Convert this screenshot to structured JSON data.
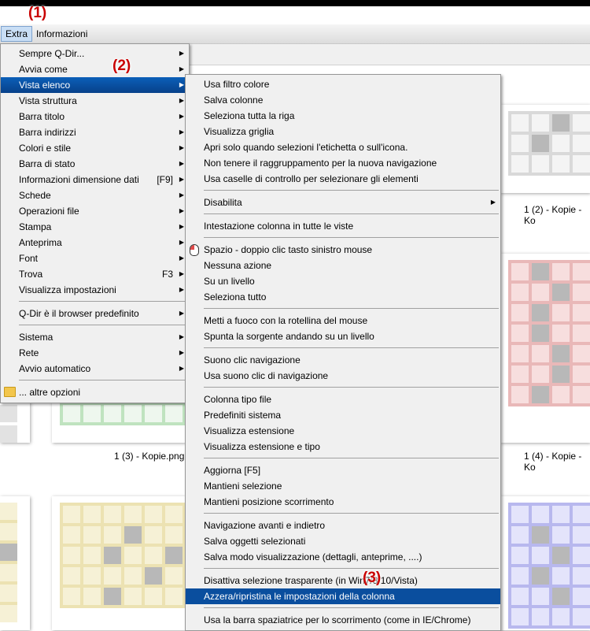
{
  "menubar": {
    "extra": "Extra",
    "info": "Informazioni"
  },
  "callouts": [
    "(1)",
    "(2)",
    "(3)"
  ],
  "extra_menu": [
    {
      "label": "Sempre Q-Dir...",
      "arrow": true
    },
    {
      "label": "Avvia come",
      "arrow": true
    },
    {
      "label": "Vista elenco",
      "arrow": true,
      "selected": true
    },
    {
      "label": "Vista struttura",
      "arrow": true
    },
    {
      "label": "Barra titolo",
      "arrow": true
    },
    {
      "label": "Barra indirizzi",
      "arrow": true
    },
    {
      "label": "Colori e stile",
      "arrow": true
    },
    {
      "label": "Barra di stato",
      "arrow": true
    },
    {
      "label": "Informazioni dimensione dati",
      "shortcut": "[F9]",
      "arrow": true
    },
    {
      "label": "Schede",
      "arrow": true
    },
    {
      "label": "Operazioni file",
      "arrow": true
    },
    {
      "label": "Stampa",
      "arrow": true
    },
    {
      "label": "Anteprima",
      "arrow": true
    },
    {
      "label": "Font",
      "arrow": true
    },
    {
      "label": "Trova",
      "shortcut": "F3",
      "arrow": true
    },
    {
      "label": "Visualizza impostazioni",
      "arrow": true
    },
    {
      "sep": true
    },
    {
      "label": "Q-Dir è il browser predefinito",
      "arrow": true
    },
    {
      "sep": true
    },
    {
      "label": "Sistema",
      "arrow": true
    },
    {
      "label": "Rete",
      "arrow": true
    },
    {
      "label": "Avvio automatico",
      "arrow": true
    },
    {
      "sep": true
    },
    {
      "label": "... altre opzioni",
      "icon": "folder-icon"
    }
  ],
  "sub_menu": [
    {
      "label": "Usa filtro colore"
    },
    {
      "label": "Salva colonne"
    },
    {
      "label": "Seleziona tutta la riga"
    },
    {
      "label": "Visualizza griglia"
    },
    {
      "label": "Apri solo quando selezioni l'etichetta o sull'icona."
    },
    {
      "label": "Non tenere il raggruppamento per la nuova navigazione"
    },
    {
      "label": "Usa caselle di controllo per selezionare gli elementi"
    },
    {
      "sep": true
    },
    {
      "label": "Disabilita",
      "arrow": true
    },
    {
      "sep": true
    },
    {
      "label": "Intestazione colonna in tutte le viste"
    },
    {
      "sep": true
    },
    {
      "label": "Spazio - doppio clic tasto sinistro mouse",
      "icon": "mouse-icon"
    },
    {
      "label": "Nessuna azione"
    },
    {
      "label": "Su un livello"
    },
    {
      "label": "Seleziona tutto"
    },
    {
      "sep": true
    },
    {
      "label": "Metti a fuoco con la rotellina del mouse"
    },
    {
      "label": "Spunta la sorgente andando su un livello"
    },
    {
      "sep": true
    },
    {
      "label": "Suono clic navigazione"
    },
    {
      "label": "Usa suono clic di navigazione"
    },
    {
      "sep": true
    },
    {
      "label": "Colonna tipo file"
    },
    {
      "label": "Predefiniti sistema"
    },
    {
      "label": "Visualizza estensione"
    },
    {
      "label": "Visualizza estensione e tipo"
    },
    {
      "sep": true
    },
    {
      "label": "Aggiorna [F5]"
    },
    {
      "label": "Mantieni selezione"
    },
    {
      "label": "Mantieni posizione scorrimento"
    },
    {
      "sep": true
    },
    {
      "label": "Navigazione avanti e indietro"
    },
    {
      "label": "Salva oggetti selezionati"
    },
    {
      "label": "Salva modo visualizzazione (dettagli, anteprime, ....)"
    },
    {
      "sep": true
    },
    {
      "label": "Disattiva selezione trasparente (in Win7/8/10/Vista)"
    },
    {
      "label": "Azzera/ripristina le impostazioni della colonna",
      "selected": true
    },
    {
      "sep": true
    },
    {
      "label": "Usa la barra spaziatrice per lo scorrimento (come in IE/Chrome)"
    }
  ],
  "captions": {
    "c1": "1 (2) - Kopie - Ko",
    "c2": "1 (3) - Kopie.png",
    "c3": "1 (4) - Kopie - Ko"
  },
  "colors": {
    "gray_tile": "#d9d9d9",
    "gray_dark": "#b8b8b8",
    "red_tile": "#e9b8b8",
    "green_tile": "#bfe3bf",
    "yellow_tile": "#ece2b2",
    "blue_tile": "#b8b8ee",
    "highlight": "#0a4e9e"
  }
}
